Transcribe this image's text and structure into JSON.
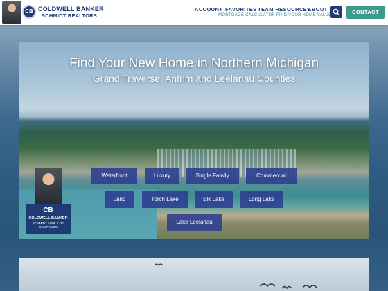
{
  "header": {
    "brand_line1": "COLDWELL BANKER",
    "brand_line2": "SCHMIDT REALTORS",
    "seal_text": "CB",
    "nav": [
      {
        "label": "ACCOUNT"
      },
      {
        "label": "FAVORITES"
      },
      {
        "label": "TEAM RESOURCES"
      },
      {
        "label": "ABOUT"
      }
    ],
    "subnav": [
      {
        "label": "MORTGAGE CALCULATOR"
      },
      {
        "label": "FIND YOUR HOME VALUE"
      }
    ],
    "search_icon": "search-icon",
    "contact_label": "CONTACT",
    "colors": {
      "brand_navy": "#1f3b73",
      "accent_teal": "#3f9a8e"
    }
  },
  "hero": {
    "title": "Find Your New Home in Northern Michigan",
    "subtitle": "Grand Traverse, Antrim and Leelanau Counties",
    "categories": [
      {
        "label": "Waterfront"
      },
      {
        "label": "Luxury"
      },
      {
        "label": "Single Family"
      },
      {
        "label": "Commercial"
      },
      {
        "label": "Land"
      },
      {
        "label": "Torch Lake"
      },
      {
        "label": "Elk Lake"
      },
      {
        "label": "Long Lake"
      },
      {
        "label": "Lake Leelanau"
      }
    ],
    "button_color": "#2b3e91"
  },
  "agent_card": {
    "mark": "CB",
    "brand": "COLDWELL BANKER",
    "sub": "SCHMIDT FAMILY OF COMPANIES"
  }
}
